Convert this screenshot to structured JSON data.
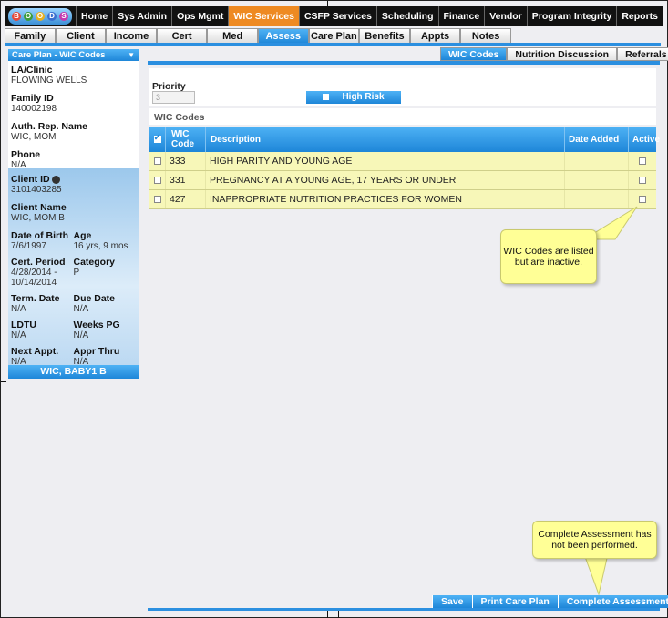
{
  "topnav": {
    "logo_letters": [
      "B",
      "O",
      "O",
      "D",
      "S"
    ],
    "items": [
      "Home",
      "Sys Admin",
      "Ops Mgmt",
      "WIC Services",
      "CSFP Services",
      "Scheduling",
      "Finance",
      "Vendor",
      "Program Integrity",
      "Reports"
    ],
    "active": "WIC Services",
    "active_color": "#ee8a22"
  },
  "tabs": [
    "Family",
    "Client",
    "Income",
    "Cert",
    "Med",
    "Assess",
    "Care Plan",
    "Benefits",
    "Appts",
    "Notes"
  ],
  "active_tab": "Assess",
  "left_panel": {
    "header": "Care Plan - WIC Codes",
    "la_clinic_label": "LA/Clinic",
    "la_clinic_value": "FLOWING WELLS",
    "family_id_label": "Family ID",
    "family_id_value": "140002198",
    "auth_rep_label": "Auth. Rep. Name",
    "auth_rep_value": "WIC, MOM",
    "phone_label": "Phone",
    "phone_value": "N/A",
    "client_id_label": "Client ID",
    "client_id_value": "3101403285",
    "client_name_label": "Client Name",
    "client_name_value": "WIC, MOM B",
    "dob_label": "Date of Birth",
    "dob_value": "7/6/1997",
    "age_label": "Age",
    "age_value": "16 yrs, 9 mos",
    "cert_period_label": "Cert. Period",
    "cert_period_value1": "4/28/2014 -",
    "cert_period_value2": "10/14/2014",
    "category_label": "Category",
    "category_value": "P",
    "term_date_label": "Term. Date",
    "term_date_value": "N/A",
    "due_date_label": "Due Date",
    "due_date_value": "N/A",
    "ldtu_label": "LDTU",
    "ldtu_value": "N/A",
    "weeks_pg_label": "Weeks PG",
    "weeks_pg_value": "N/A",
    "next_appt_label": "Next Appt.",
    "next_appt_value": "N/A",
    "appr_thru_label": "Appr Thru",
    "appr_thru_value": "N/A",
    "footer": "WIC, BABY1 B"
  },
  "subtabs": [
    "WIC Codes",
    "Nutrition Discussion",
    "Referrals"
  ],
  "active_subtab": "WIC Codes",
  "priority": {
    "label": "Priority",
    "value": "3",
    "high_risk_label": "High Risk"
  },
  "wic_codes": {
    "title": "WIC Codes",
    "columns": {
      "code_line1": "WIC",
      "code_line2": "Code",
      "description": "Description",
      "date_added": "Date Added",
      "active": "Active"
    },
    "rows": [
      {
        "code": "333",
        "description": "HIGH PARITY AND YOUNG AGE",
        "date_added": ""
      },
      {
        "code": "331",
        "description": "PREGNANCY AT A YOUNG AGE, 17 YEARS OR UNDER",
        "date_added": ""
      },
      {
        "code": "427",
        "description": "INAPPROPRIATE NUTRITION PRACTICES FOR WOMEN",
        "date_added": ""
      }
    ]
  },
  "callouts": {
    "inactive_line1": "WIC Codes are listed",
    "inactive_line2": "but are inactive.",
    "assessment_line1": "Complete Assessment has",
    "assessment_line2": "not been performed."
  },
  "buttons": {
    "save": "Save",
    "print_care_plan": "Print Care Plan",
    "complete_assessment": "Complete Assessment"
  }
}
